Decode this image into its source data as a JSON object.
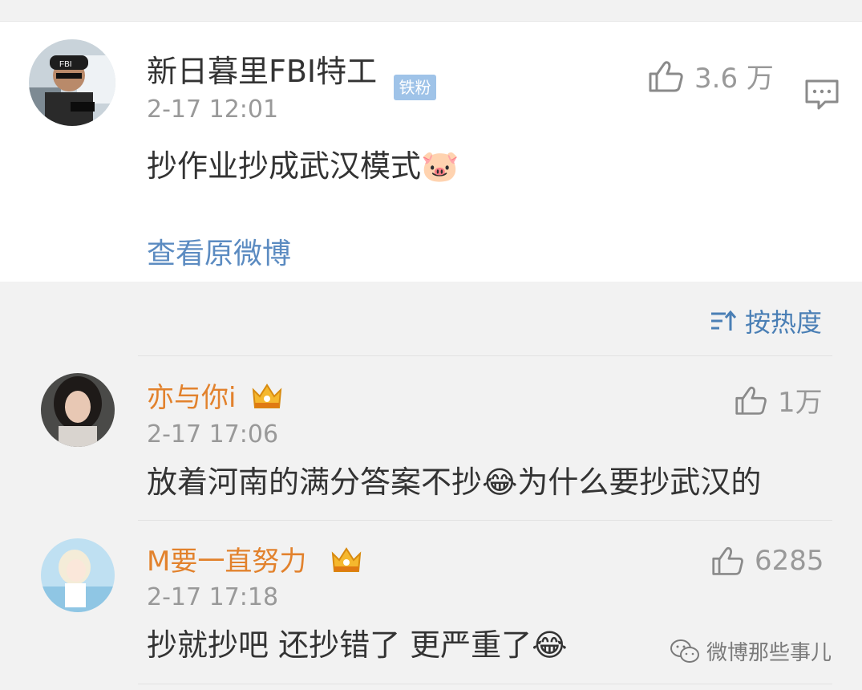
{
  "post": {
    "username": "新日暮里FBI特工",
    "badge": "铁粉",
    "time": "2-17 12:01",
    "text": "抄作业抄成武汉模式🐷",
    "likes": "3.6 万",
    "view_original": "查看原微博"
  },
  "sort": {
    "label": "按热度"
  },
  "comments": [
    {
      "username": "亦与你i",
      "time": "2-17 17:06",
      "text": "放着河南的满分答案不抄😂为什么要抄武汉的",
      "likes": "1万"
    },
    {
      "username": "M要一直努力",
      "time": "2-17 17:18",
      "text": "抄就抄吧  还抄错了  更严重了😂",
      "likes": "6285"
    }
  ],
  "watermark": {
    "text": "微博那些事儿"
  },
  "colors": {
    "link": "#5b8bc1",
    "vip_name": "#e2822d",
    "muted": "#999999",
    "badge": "#9fc3e8"
  }
}
